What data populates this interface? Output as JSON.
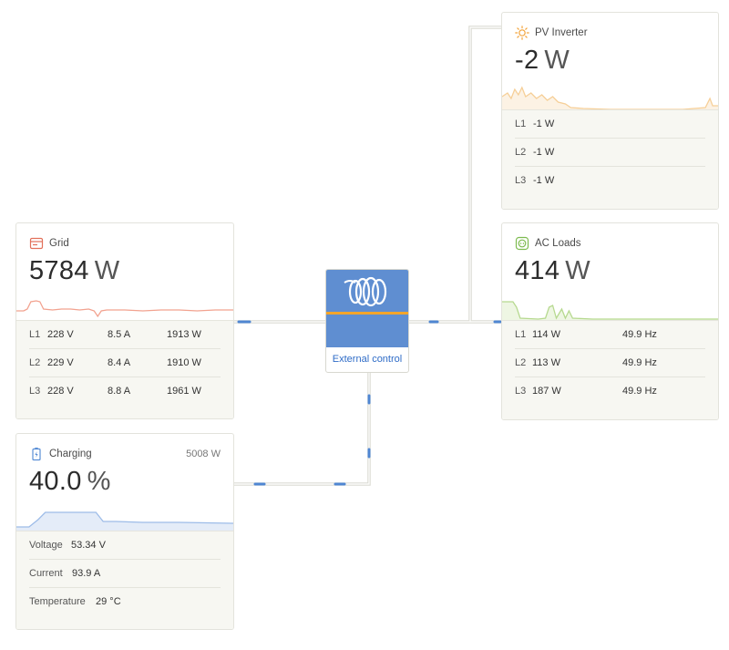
{
  "colors": {
    "grid_icon": "#e2705a",
    "grid_spark": "#f2a28f",
    "pv_icon": "#f2a33a",
    "pv_spark": "#f6cf98",
    "ac_icon": "#7dbb4f",
    "ac_spark": "#b6d98f",
    "battery_icon": "#5a8fd6",
    "battery_spark": "#9dbce8",
    "battery_fill": "#e4ecf8",
    "brand_blue": "#5f8ed1",
    "brand_orange": "#f3a52a",
    "wire": "#dcdcd4",
    "wire_flow": "#4f86d2"
  },
  "grid": {
    "title": "Grid",
    "icon": "grid-meter-icon",
    "power_value": "5784",
    "power_unit": "W",
    "phases": [
      {
        "label": "L1",
        "voltage": "228 V",
        "current": "8.5 A",
        "power": "1913 W"
      },
      {
        "label": "L2",
        "voltage": "229 V",
        "current": "8.4 A",
        "power": "1910 W"
      },
      {
        "label": "L3",
        "voltage": "228 V",
        "current": "8.8 A",
        "power": "1961 W"
      }
    ]
  },
  "pv_inverter": {
    "title": "PV Inverter",
    "icon": "sun-icon",
    "power_value": "-2",
    "power_unit": "W",
    "phases": [
      {
        "label": "L1",
        "power": "-1 W"
      },
      {
        "label": "L2",
        "power": "-1 W"
      },
      {
        "label": "L3",
        "power": "-1 W"
      }
    ]
  },
  "ac_loads": {
    "title": "AC Loads",
    "icon": "outlet-icon",
    "power_value": "414",
    "power_unit": "W",
    "phases": [
      {
        "label": "L1",
        "power": "114 W",
        "frequency": "49.9 Hz"
      },
      {
        "label": "L2",
        "power": "113 W",
        "frequency": "49.9 Hz"
      },
      {
        "label": "L3",
        "power": "187 W",
        "frequency": "49.9 Hz"
      }
    ]
  },
  "battery": {
    "title": "Charging",
    "icon": "battery-charging-icon",
    "power": "5008 W",
    "soc_value": "40.0",
    "soc_unit": "%",
    "details": [
      {
        "label": "Voltage",
        "value": "53.34 V"
      },
      {
        "label": "Current",
        "value": "93.9 A"
      },
      {
        "label": "Temperature",
        "value": "29 °C"
      }
    ]
  },
  "inverter": {
    "logo": "victron-logo-icon",
    "mode": "External control"
  }
}
